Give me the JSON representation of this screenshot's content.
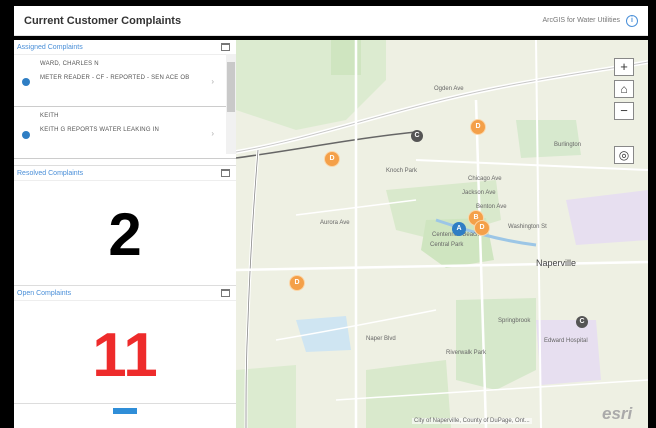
{
  "header": {
    "title": "Current Customer Complaints",
    "subtitle": "ArcGIS for Water Utilities"
  },
  "assigned": {
    "title": "Assigned Complaints",
    "items": [
      {
        "name": "WARD, CHARLES N",
        "desc": "METER READER - CF - REPORTED - SEN ACE OB"
      },
      {
        "name": "KEITH",
        "desc": "KEITH G REPORTS WATER LEAKING IN"
      }
    ]
  },
  "resolved": {
    "title": "Resolved Complaints",
    "count": "2",
    "color": "#000000"
  },
  "open": {
    "title": "Open Complaints",
    "count": "11",
    "color": "#ee2b2b"
  },
  "map": {
    "controls": {
      "zoom_in": "+",
      "home": "⌂",
      "zoom_out": "−",
      "locate": "◎"
    },
    "labels": [
      "Ogden Ave",
      "Knoch Park",
      "Centennial Beach",
      "Naperville",
      "Burlington",
      "Edward Hospital",
      "Springbrook",
      "Jackson Ave",
      "Benton Ave",
      "Washington St",
      "Chicago Ave",
      "Aurora Ave",
      "Naper Blvd",
      "Riverwalk Park",
      "Central Park"
    ],
    "markers": {
      "a": "A",
      "b": "B",
      "c": "C",
      "d": "D"
    },
    "attribution": "City of Naperville, County of DuPage, Ont...",
    "logo": "esri"
  },
  "colors": {
    "accent": "#2f7ec4",
    "marker_orange": "#f4a049",
    "marker_gray": "#555555"
  }
}
